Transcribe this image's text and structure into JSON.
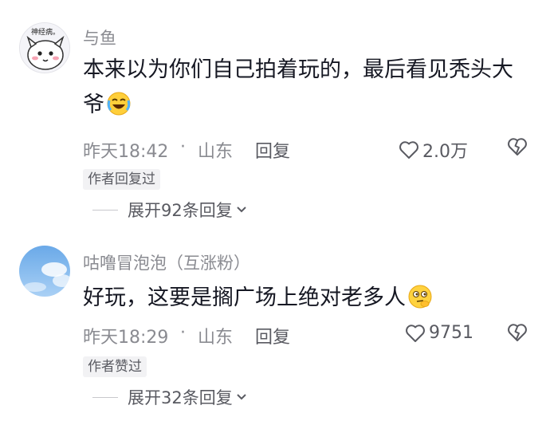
{
  "comments": [
    {
      "username": "与鱼",
      "avatar_caption": "神经病。",
      "text": "本来以为你们自己拍着玩的，最后看见秃头大爷",
      "emoji": "laughing-crying-emoji",
      "time": "昨天18:42",
      "separator": "·",
      "location": "山东",
      "reply_label": "回复",
      "likes": "2.0万",
      "author_badge": "作者回复过",
      "expand_label": "展开92条回复"
    },
    {
      "username": "咕噜冒泡泡（互涨粉）",
      "text": "好玩，这要是搁广场上绝对老多人",
      "emoji": "thinking-emoji",
      "time": "昨天18:29",
      "separator": "·",
      "location": "山东",
      "reply_label": "回复",
      "likes": "9751",
      "author_badge": "作者赞过",
      "expand_label": "展开32条回复"
    }
  ],
  "colors": {
    "text_primary": "#161823",
    "text_secondary": "#8a8b91",
    "badge_bg": "#f2f2f4"
  },
  "icons": [
    "heart-icon",
    "dislike-heart-icon",
    "chevron-down-icon"
  ]
}
